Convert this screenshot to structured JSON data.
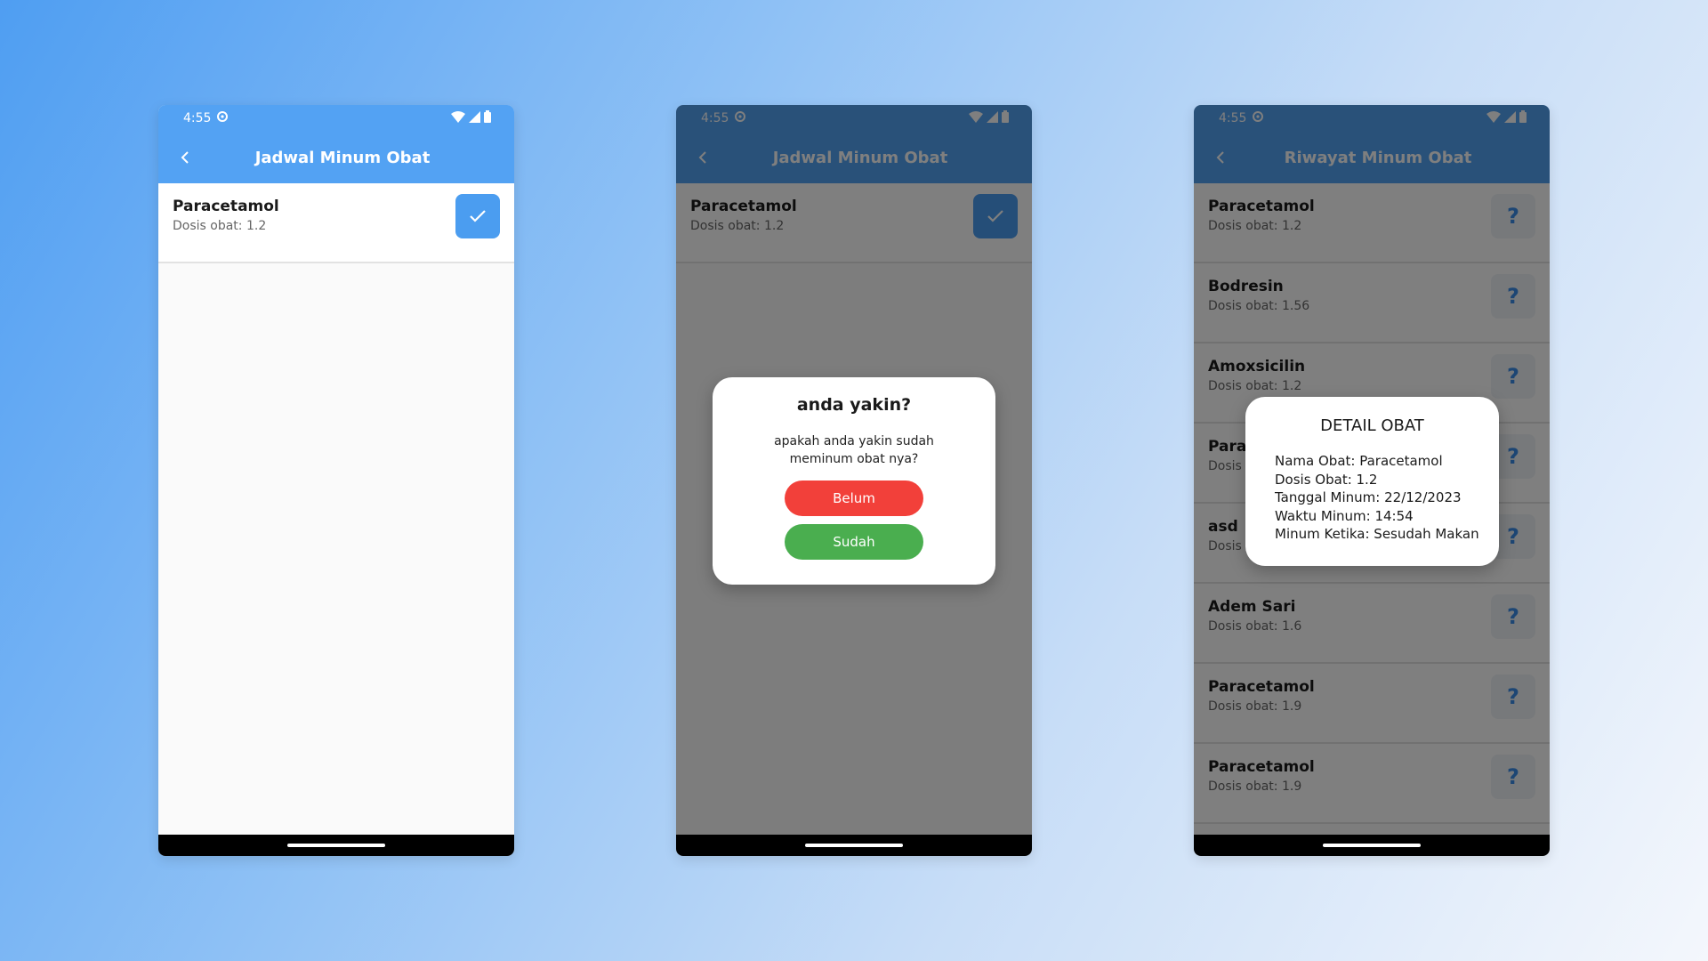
{
  "status": {
    "time": "4:55"
  },
  "colors": {
    "appbar_blue": "#53a2f3",
    "button_blue": "#4b9df0",
    "belum_red": "#f2403a",
    "sudah_green": "#4aae4f"
  },
  "screen1": {
    "title": "Jadwal Minum Obat",
    "items": [
      {
        "name": "Paracetamol",
        "dose": "Dosis obat: 1.2"
      }
    ]
  },
  "screen2": {
    "title": "Jadwal Minum Obat",
    "items": [
      {
        "name": "Paracetamol",
        "dose": "Dosis obat: 1.2"
      }
    ],
    "dialog": {
      "title": "anda yakin?",
      "message_line1": "apakah anda yakin sudah",
      "message_line2": "meminum obat nya?",
      "belum_label": "Belum",
      "sudah_label": "Sudah"
    }
  },
  "screen3": {
    "title": "Riwayat Minum Obat",
    "items": [
      {
        "name": "Paracetamol",
        "dose": "Dosis obat: 1.2"
      },
      {
        "name": "Bodresin",
        "dose": "Dosis obat: 1.56"
      },
      {
        "name": "Amoxsicilin",
        "dose": "Dosis obat: 1.2"
      },
      {
        "name": "Para",
        "dose": "Dosis"
      },
      {
        "name": "asd",
        "dose": "Dosis"
      },
      {
        "name": "Adem Sari",
        "dose": "Dosis obat: 1.6"
      },
      {
        "name": "Paracetamol",
        "dose": "Dosis obat: 1.9"
      },
      {
        "name": "Paracetamol",
        "dose": "Dosis obat: 1.9"
      }
    ],
    "help_glyph": "?",
    "detail": {
      "title": "DETAIL OBAT",
      "nama": "Nama Obat: Paracetamol",
      "dosis": "Dosis Obat: 1.2",
      "tanggal": "Tanggal Minum: 22/12/2023",
      "waktu": "Waktu Minum: 14:54",
      "ketika": "Minum Ketika: Sesudah Makan"
    }
  },
  "icons": {
    "back": "chevron-left-icon",
    "check": "check-icon",
    "settings": "gear-icon",
    "wifi": "wifi-icon",
    "signal": "signal-icon",
    "battery": "battery-icon"
  }
}
